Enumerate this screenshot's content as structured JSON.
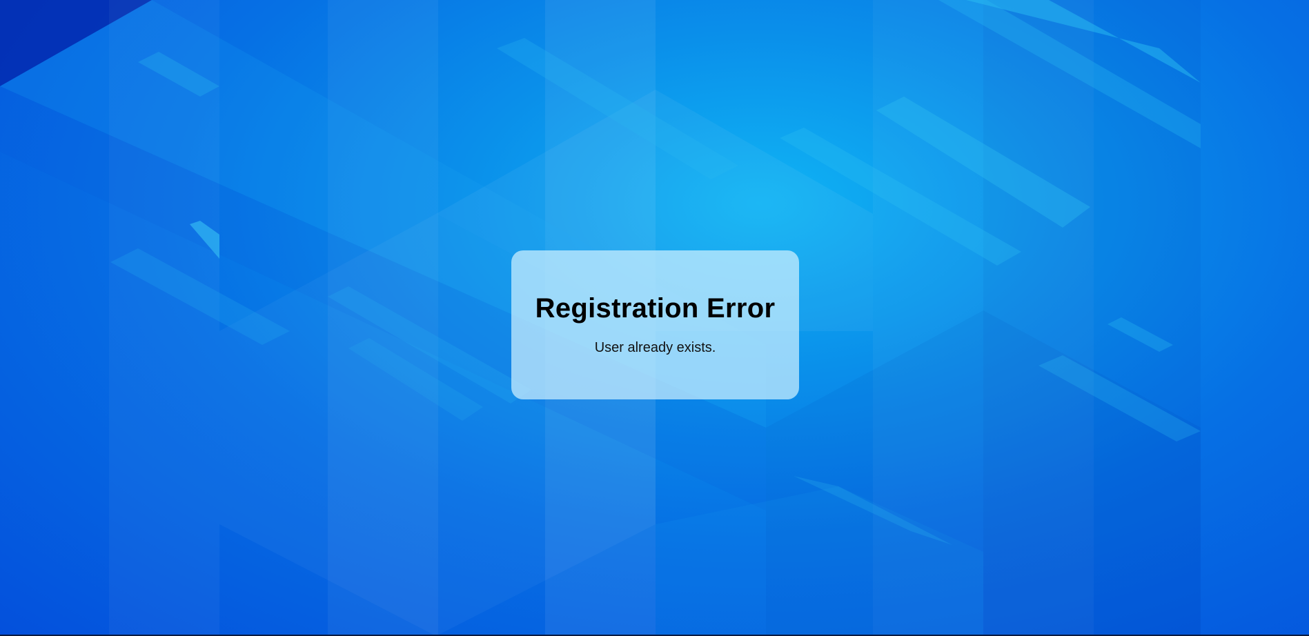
{
  "dialog": {
    "title": "Registration Error",
    "message": "User already exists."
  },
  "colors": {
    "background_center": "#10b4f4",
    "background_edge": "#0450dc",
    "card_background": "rgba(205, 240, 255, 0.72)",
    "title_text": "#000000"
  }
}
